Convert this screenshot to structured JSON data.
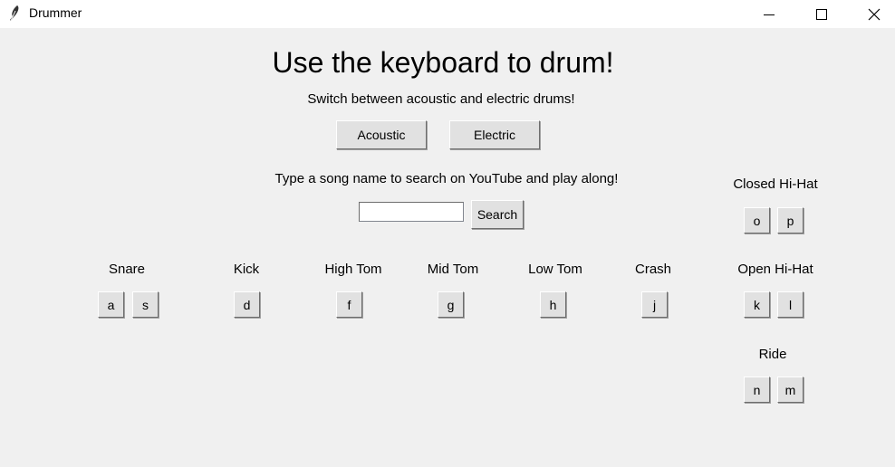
{
  "window": {
    "title": "Drummer",
    "icons": {
      "app": "feather-icon",
      "minimize": "minimize-icon",
      "maximize": "maximize-icon",
      "close": "close-icon"
    }
  },
  "header": {
    "title": "Use the keyboard to drum!",
    "subtitle": "Switch between acoustic and electric drums!"
  },
  "kit_buttons": {
    "acoustic": "Acoustic",
    "electric": "Electric"
  },
  "search": {
    "prompt": "Type a song name to search on YouTube and play along!",
    "value": "",
    "button": "Search"
  },
  "drums": {
    "snare": {
      "label": "Snare",
      "keys": [
        "a",
        "s"
      ]
    },
    "kick": {
      "label": "Kick",
      "keys": [
        "d"
      ]
    },
    "high_tom": {
      "label": "High Tom",
      "keys": [
        "f"
      ]
    },
    "mid_tom": {
      "label": "Mid Tom",
      "keys": [
        "g"
      ]
    },
    "low_tom": {
      "label": "Low Tom",
      "keys": [
        "h"
      ]
    },
    "crash": {
      "label": "Crash",
      "keys": [
        "j"
      ]
    },
    "closed_hihat": {
      "label": "Closed Hi-Hat",
      "keys": [
        "o",
        "p"
      ]
    },
    "open_hihat": {
      "label": "Open Hi-Hat",
      "keys": [
        "k",
        "l"
      ]
    },
    "ride": {
      "label": "Ride",
      "keys": [
        "n",
        "m"
      ]
    }
  }
}
